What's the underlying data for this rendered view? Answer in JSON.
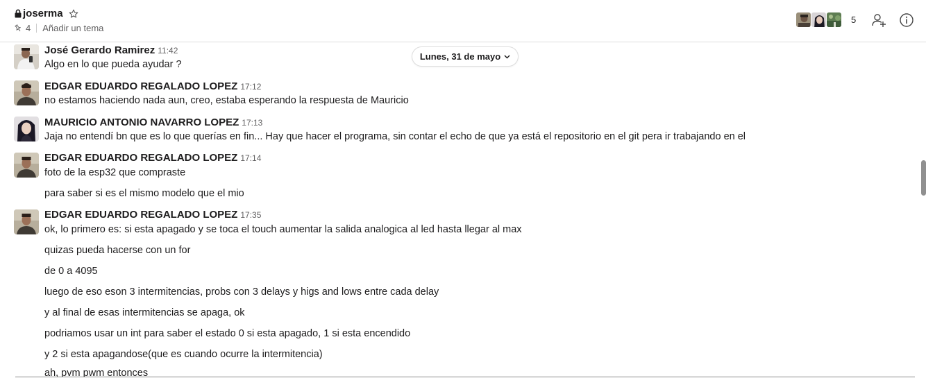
{
  "channel": {
    "name": "joserma",
    "pinned_count": "4",
    "topic_placeholder": "Añadir un tema",
    "member_count": "5"
  },
  "icons": {
    "lock": "lock-icon",
    "star": "star-icon",
    "pin": "pin-icon",
    "add_member": "add-user-icon",
    "info": "info-icon",
    "chevron": "chevron-down-icon"
  },
  "date_divider": "Lunes, 31 de mayo",
  "messages": [
    {
      "sender": "José Gerardo Ramirez",
      "time": "11:42",
      "lines": [
        "Algo en lo que pueda ayudar ?"
      ]
    },
    {
      "sender": "EDGAR EDUARDO REGALADO LOPEZ",
      "time": "17:12",
      "lines": [
        "no estamos haciendo nada aun, creo, estaba esperando la respuesta de Mauricio"
      ]
    },
    {
      "sender": "MAURICIO ANTONIO NAVARRO LOPEZ",
      "time": "17:13",
      "lines": [
        "Jaja no entendí bn que es lo que querías en fin... Hay que hacer el programa, sin contar el echo de que ya está el repositorio en el git pera ir trabajando en el"
      ]
    },
    {
      "sender": "EDGAR EDUARDO REGALADO LOPEZ",
      "time": "17:14",
      "lines": [
        "foto de la esp32 que compraste",
        "para saber si es el mismo modelo que el mio"
      ]
    },
    {
      "sender": "EDGAR EDUARDO REGALADO LOPEZ",
      "time": "17:35",
      "lines": [
        "ok, lo primero es: si esta apagado y se toca el touch aumentar la salida analogica al led hasta llegar al max",
        "quizas pueda hacerse con un for",
        "de 0 a 4095",
        "luego de eso eson 3 intermitencias, probs con 3 delays y higs and lows entre cada delay",
        "y al final de esas intermitencias se apaga, ok",
        "podriamos usar un int para saber el estado 0 si esta apagado, 1 si esta encendido",
        "y 2 si esta apagandose(que es cuando ocurre la intermitencia)",
        "ah, pvm pwm entonces"
      ]
    }
  ],
  "colors": {
    "text": "#1d1c1d",
    "muted": "#616061",
    "border": "#dddddd"
  }
}
